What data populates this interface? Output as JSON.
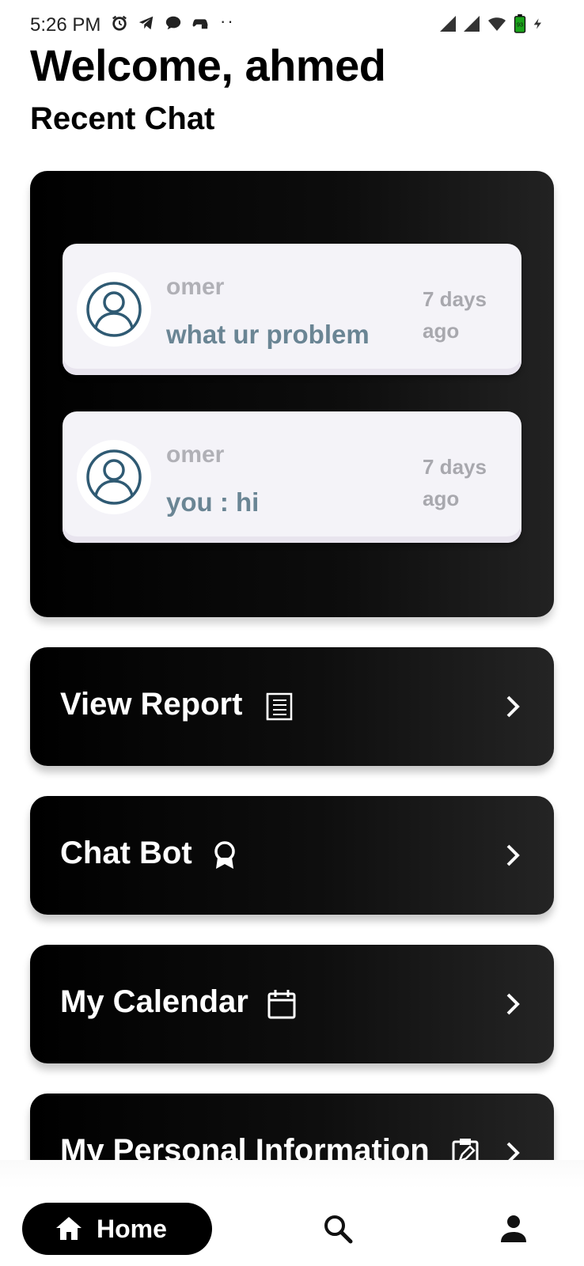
{
  "status_bar": {
    "time": "5:26 PM",
    "left_icons": [
      "alarm-icon",
      "telegram-icon",
      "chat-bubble-icon",
      "game-controller-icon"
    ],
    "more_dots": "··",
    "right_icons": [
      "signal-icon",
      "signal-icon",
      "wifi-icon",
      "battery-charging-icon"
    ],
    "battery_level": "93"
  },
  "header": {
    "welcome": "Welcome, ahmed",
    "recent_title": "Recent Chat"
  },
  "recent_chats": [
    {
      "name": "omer",
      "message": "what ur problem",
      "time": "7 days ago"
    },
    {
      "name": "omer",
      "message": "you : hi",
      "time": "7 days ago"
    }
  ],
  "menu": [
    {
      "label": "View Report",
      "icon": "report-icon"
    },
    {
      "label": "Chat Bot",
      "icon": "award-icon"
    },
    {
      "label": "My Calendar",
      "icon": "calendar-icon"
    },
    {
      "label": "My Personal Information",
      "icon": "clipboard-edit-icon"
    }
  ],
  "bottom_nav": {
    "home_label": "Home",
    "items": [
      "home-icon",
      "search-icon",
      "profile-icon"
    ]
  },
  "colors": {
    "card_bg": "#000000",
    "chat_card_bg": "#f4f3f8",
    "chat_message": "#6a8594",
    "chat_meta": "#b0b0b6",
    "avatar_stroke": "#2f5a73"
  }
}
